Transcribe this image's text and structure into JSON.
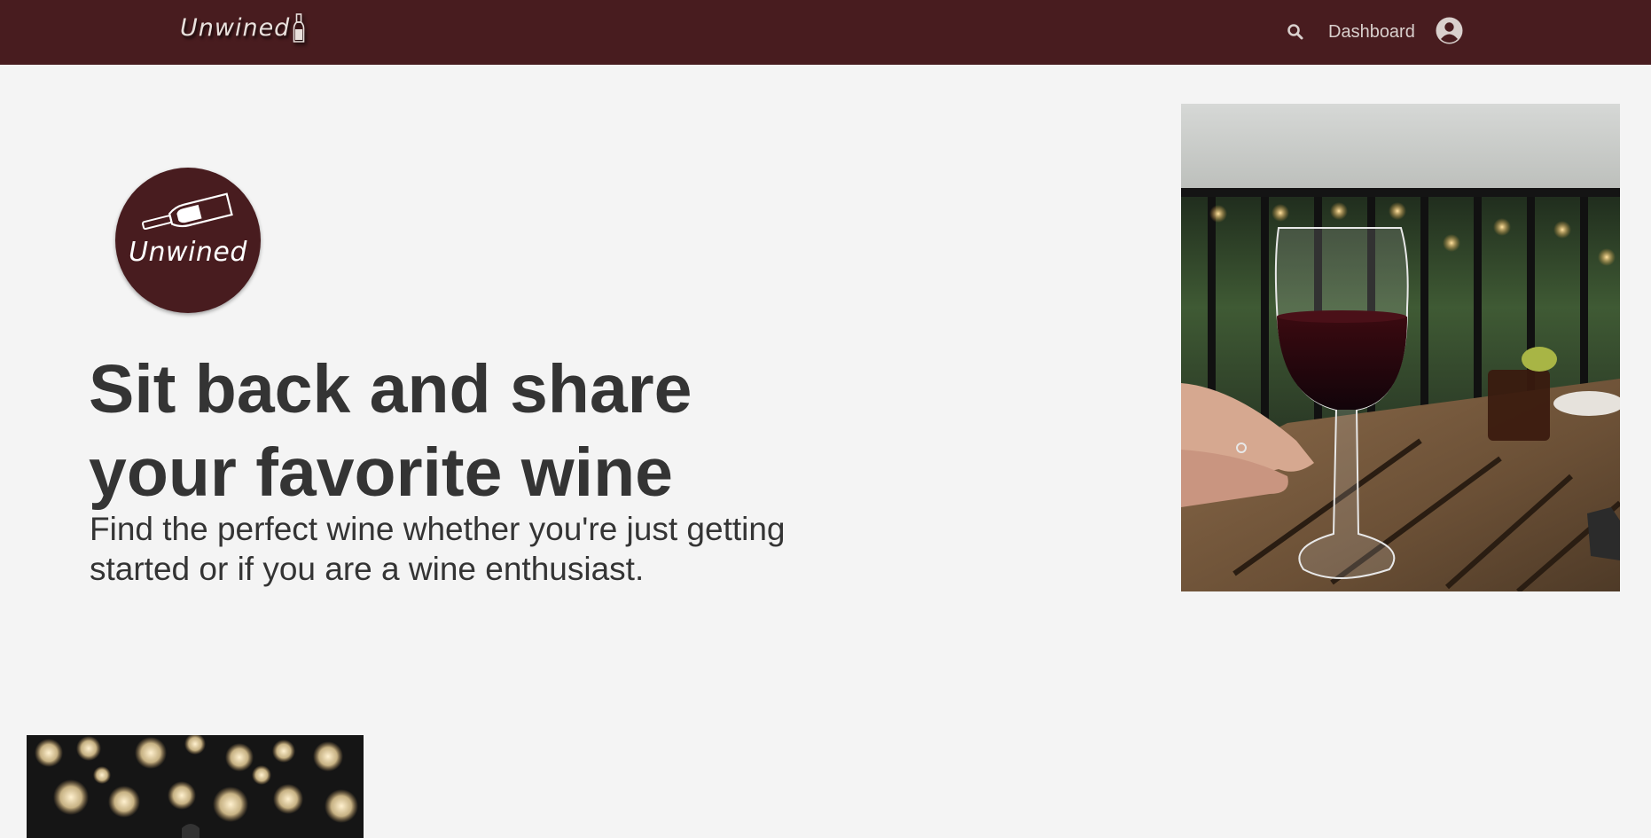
{
  "nav": {
    "logo_text": "Unwined",
    "logo_icon": "wine-bottle-icon",
    "search_icon": "search-icon",
    "dashboard_label": "Dashboard",
    "account_icon": "user-circle-icon"
  },
  "hero": {
    "badge_text": "Unwined",
    "badge_icon": "wine-bottle-icon",
    "title": "Sit back and share your favorite wine",
    "subtitle": "Find the perfect wine whether you're just getting started or if you are a wine enthusiast."
  },
  "colors": {
    "nav_background": "#481c1f",
    "page_background": "#f4f4f4",
    "heading_text": "#343434"
  }
}
